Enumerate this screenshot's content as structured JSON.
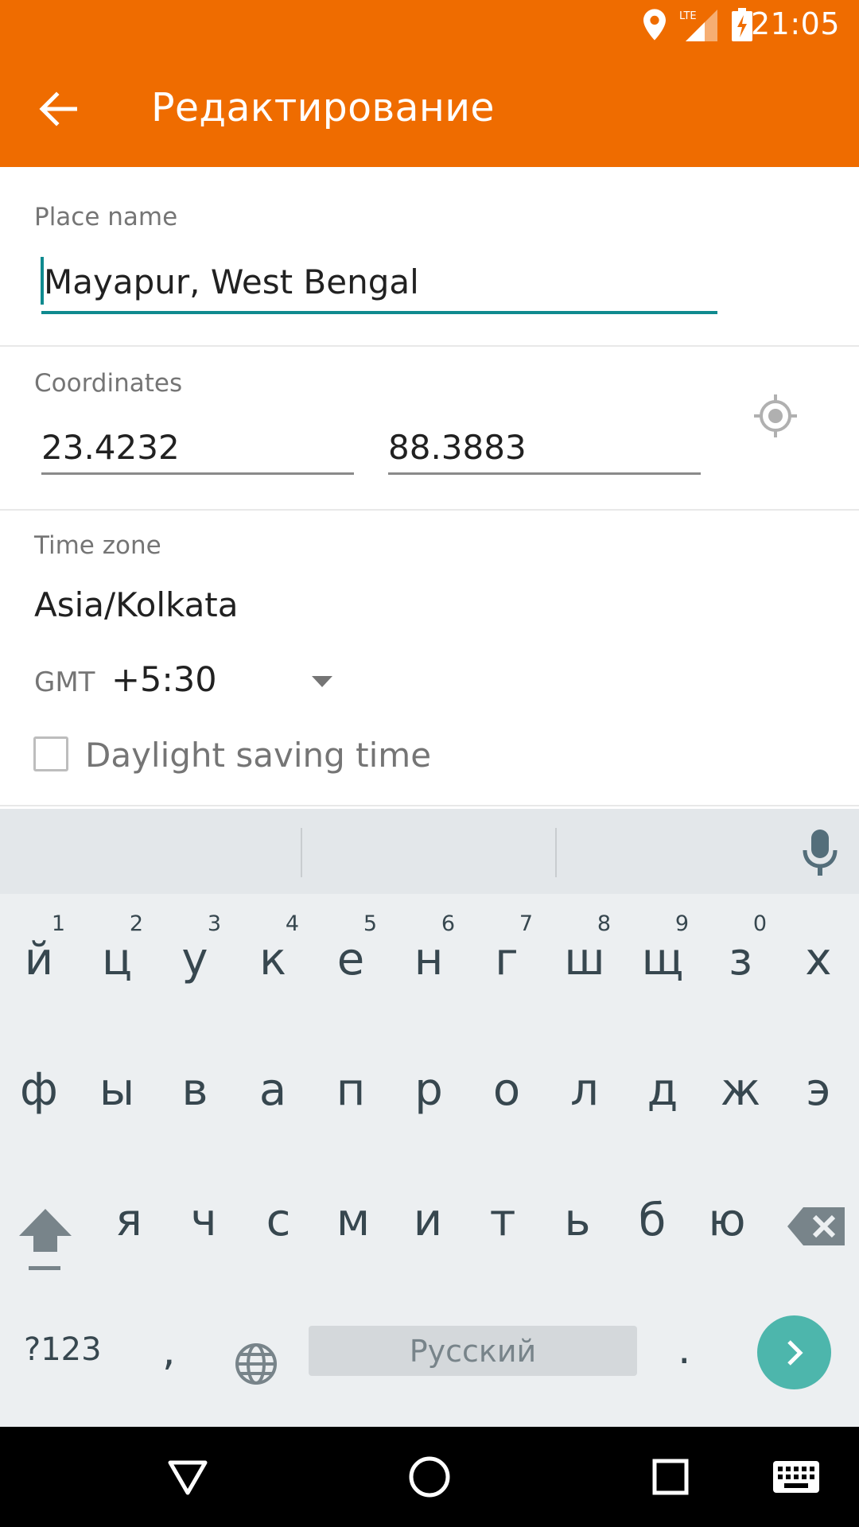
{
  "status_bar": {
    "time": "21:05",
    "network": "LTE",
    "icons": [
      "location-icon",
      "lte-signal-icon",
      "battery-charging-icon"
    ]
  },
  "app_bar": {
    "title": "Редактирование",
    "back_icon": "arrow-back-icon"
  },
  "form": {
    "place_name": {
      "label": "Place name",
      "value": "Mayapur, West Bengal"
    },
    "coordinates": {
      "label": "Coordinates",
      "latitude": "23.4232",
      "longitude": "88.3883",
      "locate_icon": "gps-locate-icon"
    },
    "time_zone": {
      "label": "Time zone",
      "value": "Asia/Kolkata",
      "gmt_label": "GMT",
      "gmt_offset": "+5:30"
    },
    "daylight_saving": {
      "label": "Daylight saving time",
      "checked": false
    }
  },
  "keyboard": {
    "row1": [
      {
        "ch": "й",
        "hint": "1"
      },
      {
        "ch": "ц",
        "hint": "2"
      },
      {
        "ch": "у",
        "hint": "3"
      },
      {
        "ch": "к",
        "hint": "4"
      },
      {
        "ch": "е",
        "hint": "5"
      },
      {
        "ch": "н",
        "hint": "6"
      },
      {
        "ch": "г",
        "hint": "7"
      },
      {
        "ch": "ш",
        "hint": "8"
      },
      {
        "ch": "щ",
        "hint": "9"
      },
      {
        "ch": "з",
        "hint": "0"
      },
      {
        "ch": "х",
        "hint": ""
      }
    ],
    "row2": [
      "ф",
      "ы",
      "в",
      "а",
      "п",
      "р",
      "о",
      "л",
      "д",
      "ж",
      "э"
    ],
    "row3": [
      "я",
      "ч",
      "с",
      "м",
      "и",
      "т",
      "ь",
      "б",
      "ю"
    ],
    "symbols_label": "?123",
    "comma": ",",
    "space_label": "Русский",
    "period": "."
  },
  "nav_bar": {
    "buttons": [
      "back-triangle-icon",
      "home-circle-icon",
      "recents-square-icon",
      "keyboard-icon"
    ]
  },
  "colors": {
    "primary": "#ef6c00",
    "accent": "#0f8a8f",
    "enter_key": "#4db6ac"
  }
}
